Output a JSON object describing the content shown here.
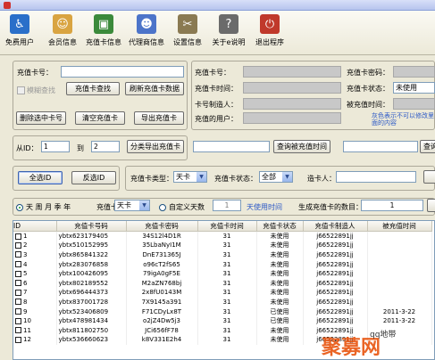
{
  "toolbar": {
    "items": [
      {
        "label": "免费用户",
        "icon": "wheelchair-icon",
        "color": "#2a6fc9",
        "glyph": "♿"
      },
      {
        "label": "会员信息",
        "icon": "user-icon",
        "color": "#d9a441",
        "glyph": "☺"
      },
      {
        "label": "充值卡信息",
        "icon": "card-icon",
        "color": "#3b8a3b",
        "glyph": "▣"
      },
      {
        "label": "代理商信息",
        "icon": "agent-icon",
        "color": "#4c74c9",
        "glyph": "☻"
      },
      {
        "label": "设置信息",
        "icon": "tools-icon",
        "color": "#8a7a52",
        "glyph": "✂"
      },
      {
        "label": "关于e说明",
        "icon": "about-icon",
        "color": "#6b6b6b",
        "glyph": "?"
      },
      {
        "label": "退出程序",
        "icon": "power-icon",
        "color": "#c0392b",
        "glyph": "⏻"
      }
    ]
  },
  "form": {
    "card_no_label": "充值卡号：",
    "fuzzy_label": "模糊查找",
    "query_btn": "充值卡查找",
    "refresh_btn": "刷新充值卡数据",
    "delete_btn": "删除选中卡号",
    "clear_btn": "清空充值卡",
    "export_btn": "导出充值卡",
    "info_card_no": "充值卡号：",
    "info_password": "充值卡密码：",
    "info_time": "充值卡时间：",
    "info_status": "充值卡状态：",
    "info_status_value": "未使用",
    "info_maker": "卡号制造人：",
    "info_used_time": "被充值时间：",
    "info_user": "充值的用户：",
    "note": "灰色表示不可以修改里面的内容",
    "from_id_label": "从ID：",
    "from_id_value": "1",
    "to_label": "到",
    "to_value": "2",
    "batch_export_btn": "分类导出充值卡",
    "query_used_btn": "查询被充值时间",
    "query_btn2": "查询",
    "select_all_btn": "全选ID",
    "invert_btn": "反选ID",
    "type_label": "充值卡类型：",
    "type_value": "天卡",
    "status_label": "充值卡状态：",
    "status_value": "全部",
    "maker_label": "造卡人：",
    "period_options": "天 周 月 季 年",
    "card_label": "充值卡",
    "unit_value": "天卡",
    "custom_label": "自定义天数",
    "custom_days": "1",
    "days_label": "天使用时间",
    "gen_label": "生成充值卡的数目：",
    "gen_count": "1"
  },
  "table": {
    "headers": [
      "ID",
      "充值卡号码",
      "充值卡密码",
      "充值卡时间",
      "充值卡状态",
      "充值卡制造人",
      "被充值时间"
    ],
    "rows": [
      [
        "1",
        "ybtx623179405",
        "34S12l4D1R",
        "31",
        "未使用",
        "j66522891jj",
        ""
      ],
      [
        "2",
        "ybtx510152995",
        "35LbaNyI1M",
        "31",
        "未使用",
        "j66522891jj",
        ""
      ],
      [
        "3",
        "ybtx865841322",
        "DnE731365J",
        "31",
        "未使用",
        "j66522891jj",
        ""
      ],
      [
        "4",
        "ybtx283076858",
        "o96cT2fS65",
        "31",
        "未使用",
        "j66522891jj",
        ""
      ],
      [
        "5",
        "ybtx100426095",
        "79igA0gF5E",
        "31",
        "未使用",
        "j66522891jj",
        ""
      ],
      [
        "6",
        "ybtx802189552",
        "M2aZN768bj",
        "31",
        "未使用",
        "j66522891jj",
        ""
      ],
      [
        "7",
        "ybtx696444373",
        "2x8fU0143M",
        "31",
        "未使用",
        "j66522891jj",
        ""
      ],
      [
        "8",
        "ybtx837001728",
        "7X9145a391",
        "31",
        "未使用",
        "j66522891jj",
        ""
      ],
      [
        "9",
        "ybtx523406809",
        "F71CDyLx8T",
        "31",
        "已使用",
        "j66522891jj",
        "2011-3-22"
      ],
      [
        "10",
        "ybtx478981434",
        "o2jZ4Dw5j3",
        "31",
        "已使用",
        "j66522891jj",
        "2011-3-22"
      ],
      [
        "11",
        "ybtx811802750",
        "JCi656fF78",
        "31",
        "未使用",
        "j66522891jj",
        ""
      ],
      [
        "12",
        "ybtx536660623",
        "k8V331E2h4",
        "31",
        "未使用",
        "j66522891jj",
        ""
      ]
    ]
  },
  "watermark": "聚募网",
  "watermark_sub": "qq地带"
}
